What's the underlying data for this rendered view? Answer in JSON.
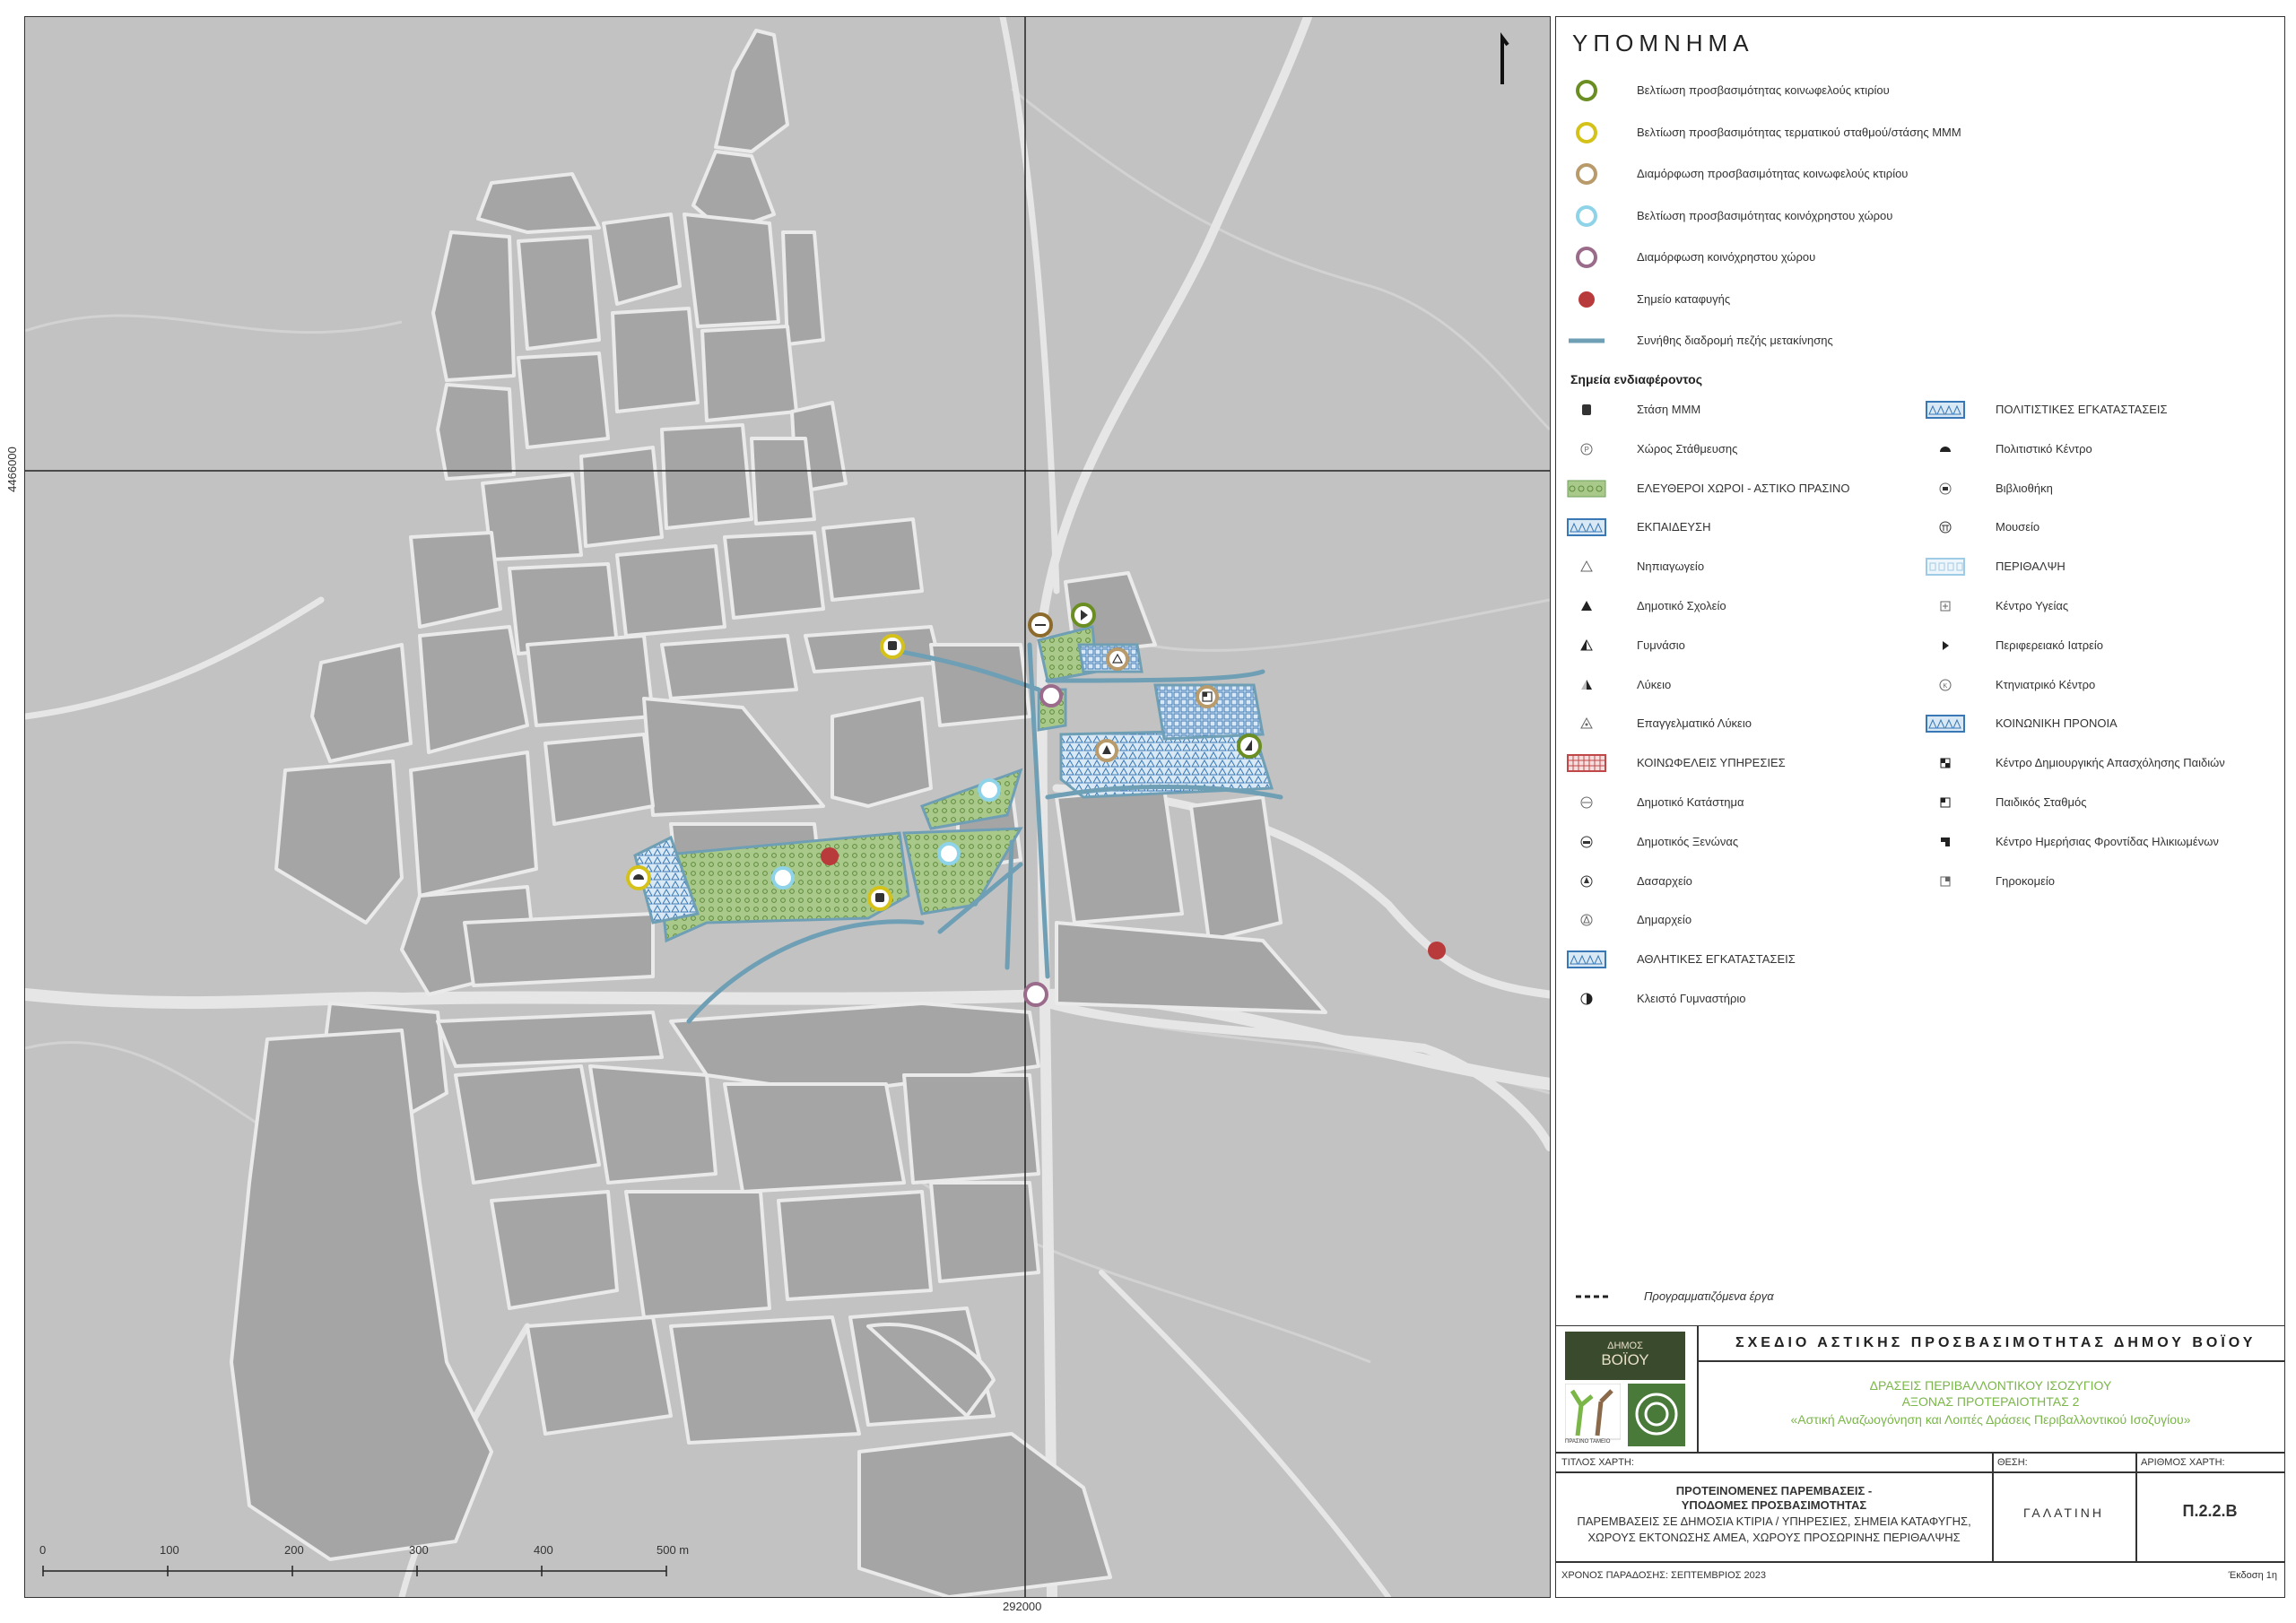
{
  "map": {
    "coordinates": {
      "northing": "4466000",
      "easting": "292000"
    },
    "scale_bar": {
      "ticks": [
        "0",
        "100",
        "200",
        "300",
        "400",
        "500 m"
      ]
    }
  },
  "legend": {
    "title": "ΥΠΟΜΝΗΜΑ",
    "items": [
      {
        "label": "Βελτίωση προσβασιμότητας κοινωφελούς κτιρίου",
        "color": "#6b8e23",
        "symbol": "ring"
      },
      {
        "label": "Βελτίωση προσβασιμότητας τερματικού σταθμού/στάσης ΜΜΜ",
        "color": "#d4c21a",
        "symbol": "ring"
      },
      {
        "label": "Διαμόρφωση προσβασιμότητας κοινωφελούς κτιρίου",
        "color": "#b89a6b",
        "symbol": "ring"
      },
      {
        "label": "Βελτίωση προσβασιμότητας κοινόχρηστου χώρου",
        "color": "#8fd3e8",
        "symbol": "ring"
      },
      {
        "label": "Διαμόρφωση κοινόχρηστου χώρου",
        "color": "#9a6b8a",
        "symbol": "ring"
      },
      {
        "label": "Σημείο καταφυγής",
        "color": "#b83a3a",
        "symbol": "dot"
      },
      {
        "label": "Συνήθης διαδρομή πεζής μετακίνησης",
        "color": "#6f9fb5",
        "symbol": "line"
      }
    ],
    "poi_heading": "Σημεία ενδιαφέροντος",
    "poi_left": [
      {
        "label": "Στάση ΜΜΜ",
        "icon": "bus-icon",
        "kind": "icon"
      },
      {
        "label": "Χώρος Στάθμευσης",
        "icon": "parking-icon",
        "kind": "icon"
      },
      {
        "label": "ΕΛΕΥΘΕΡΟΙ ΧΩΡΟΙ - ΑΣΤΙΚΟ ΠΡΑΣΙΝΟ",
        "icon": "green-hatch",
        "kind": "green"
      },
      {
        "label": "ΕΚΠΑΙΔΕΥΣΗ",
        "icon": "education-hatch",
        "kind": "blue"
      },
      {
        "label": "Νηπιαγωγείο",
        "icon": "triangle-outline-icon",
        "kind": "icon"
      },
      {
        "label": "Δημοτικό Σχολείο",
        "icon": "triangle-filled-icon",
        "kind": "icon"
      },
      {
        "label": "Γυμνάσιο",
        "icon": "triangle-half-icon",
        "kind": "icon"
      },
      {
        "label": "Λύκειο",
        "icon": "triangle-split-icon",
        "kind": "icon"
      },
      {
        "label": "Επαγγελματικό Λύκειο",
        "icon": "triangle-dot-icon",
        "kind": "icon"
      },
      {
        "label": "ΚΟΙΝΩΦΕΛΕΙΣ ΥΠΗΡΕΣΙΕΣ",
        "icon": "red-grid",
        "kind": "red"
      },
      {
        "label": "Δημοτικό Κατάστημα",
        "icon": "municipal-store-icon",
        "kind": "icon"
      },
      {
        "label": "Δημοτικός Ξενώνας",
        "icon": "guesthouse-icon",
        "kind": "icon"
      },
      {
        "label": "Δασαρχείο",
        "icon": "forest-office-icon",
        "kind": "icon"
      },
      {
        "label": "Δημαρχείο",
        "icon": "town-hall-icon",
        "kind": "icon"
      },
      {
        "label": "ΑΘΛΗΤΙΚΕΣ ΕΓΚΑΤΑΣΤΑΣΕΙΣ",
        "icon": "sport-hatch",
        "kind": "blue"
      },
      {
        "label": "Κλειστό Γυμναστήριο",
        "icon": "gym-icon",
        "kind": "icon"
      }
    ],
    "poi_right": [
      {
        "label": "ΠΟΛΙΤΙΣΤΙΚΕΣ ΕΓΚΑΤΑΣΤΑΣΕΙΣ",
        "icon": "culture-hatch",
        "kind": "blue"
      },
      {
        "label": "Πολιτιστικό Κέντρο",
        "icon": "cultural-center-icon",
        "kind": "icon"
      },
      {
        "label": "Βιβλιοθήκη",
        "icon": "library-icon",
        "kind": "icon"
      },
      {
        "label": "Μουσείο",
        "icon": "museum-icon",
        "kind": "icon"
      },
      {
        "label": "ΠΕΡΙΘΑΛΨΗ",
        "icon": "care-hatch",
        "kind": "lightblue"
      },
      {
        "label": "Κέντρο Υγείας",
        "icon": "health-center-icon",
        "kind": "icon"
      },
      {
        "label": "Περιφερειακό Ιατρείο",
        "icon": "clinic-icon",
        "kind": "icon"
      },
      {
        "label": "Κτηνιατρικό Κέντρο",
        "icon": "vet-icon",
        "kind": "icon"
      },
      {
        "label": "ΚΟΙΝΩΝΙΚΗ ΠΡΟΝΟΙΑ",
        "icon": "welfare-hatch",
        "kind": "blue"
      },
      {
        "label": "Κέντρο Δημιουργικής Απασχόλησης Παιδιών",
        "icon": "kids-center-icon",
        "kind": "icon"
      },
      {
        "label": "Παιδικός Σταθμός",
        "icon": "nursery-icon",
        "kind": "icon"
      },
      {
        "label": "Κέντρο Ημερήσιας Φροντίδας Ηλικιωμένων",
        "icon": "elderly-care-icon",
        "kind": "icon"
      },
      {
        "label": "Γηροκομείο",
        "icon": "nursing-home-icon",
        "kind": "icon"
      }
    ],
    "planned": "Προγραμματιζόμενα έργα"
  },
  "titleblock": {
    "logo_text_1": "ΔΗΜΟΣ",
    "logo_text_2": "ΒΟΪΟΥ",
    "logo_caption": "ΠΡΑΣΙΝΟ ΤΑΜΕΙΟ",
    "plan_title": "ΣΧΕΔΙΟ ΑΣΤΙΚΗΣ ΠΡΟΣΒΑΣΙΜΟΤΗΤΑΣ ΔΗΜΟΥ ΒΟΪΟΥ",
    "subtitle_1": "ΔΡΑΣΕΙΣ ΠΕΡΙΒΑΛΛΟΝΤΙΚΟΥ ΙΣΟΖΥΓΙΟΥ",
    "subtitle_2": "ΑΞΟΝΑΣ ΠΡΟΤΕΡΑΙΟΤΗΤΑΣ 2",
    "subtitle_3": "«Αστική Αναζωογόνηση και Λοιπές Δράσεις Περιβαλλοντικού Ισοζυγίου»",
    "map_title_label": "ΤΙΤΛΟΣ ΧΑΡΤΗ:",
    "location_label": "ΘΕΣΗ:",
    "map_no_label": "ΑΡΙΘΜΟΣ ΧΑΡΤΗ:",
    "map_title_1": "ΠΡΟΤΕΙΝΟΜΕΝΕΣ ΠΑΡΕΜΒΑΣΕΙΣ -",
    "map_title_2": "ΥΠΟΔΟΜΕΣ ΠΡΟΣΒΑΣΙΜΟΤΗΤΑΣ",
    "map_title_3": "ΠΑΡΕΜΒΑΣΕΙΣ ΣΕ ΔΗΜΟΣΙΑ ΚΤΙΡΙΑ / ΥΠΗΡΕΣΙΕΣ, ΣΗΜΕΙΑ ΚΑΤΑΦΥΓΗΣ,",
    "map_title_4": "ΧΩΡΟΥΣ ΕΚΤΟΝΩΣΗΣ ΑΜΕΑ, ΧΩΡΟΥΣ ΠΡΟΣΩΡΙΝΗΣ ΠΕΡΙΘΑΛΨΗΣ",
    "location": "ΓΑΛΑΤΙΝΗ",
    "map_no": "Π.2.2.Β",
    "delivery": "ΧΡΟΝΟΣ ΠΑΡΑΔΟΣΗΣ: ΣΕΠΤΕΜΒΡΙΟΣ 2023",
    "edition": "Έκδοση 1η"
  }
}
